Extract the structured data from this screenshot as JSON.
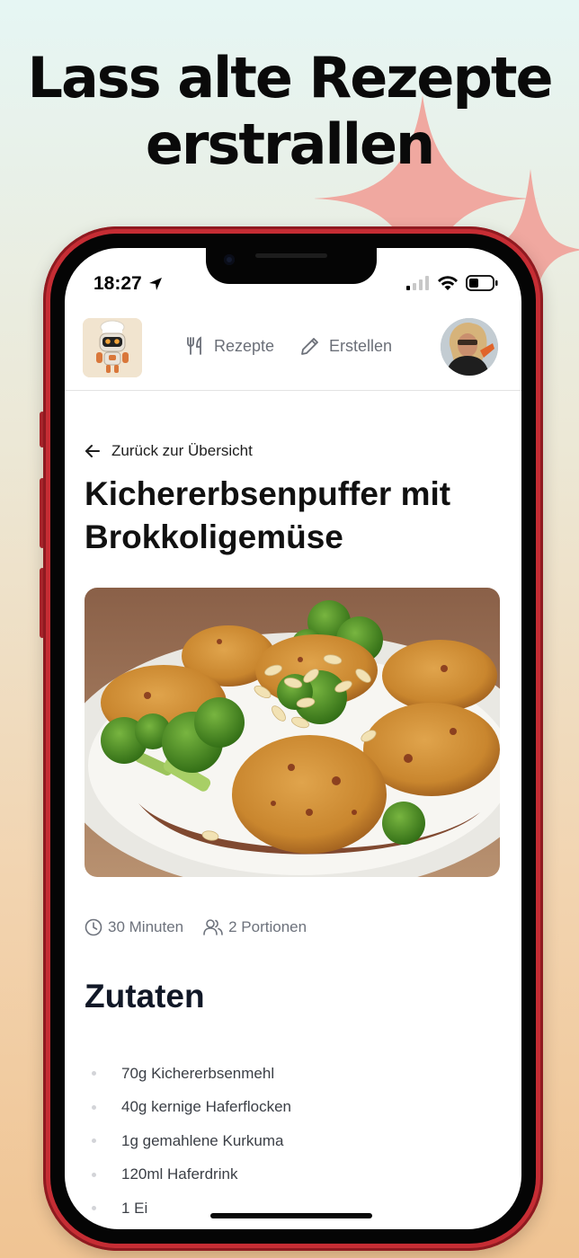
{
  "promo": {
    "headline_line1": "Lass alte Rezepte",
    "headline_line2": "erstrallen"
  },
  "status_bar": {
    "time": "18:27",
    "icons": [
      "location-arrow-icon",
      "cellular-signal-icon",
      "wifi-icon",
      "battery-icon"
    ]
  },
  "nav": {
    "logo": "robot-chef-logo",
    "links": [
      {
        "label": "Rezepte",
        "icon": "fork-knife-icon"
      },
      {
        "label": "Erstellen",
        "icon": "pencil-icon"
      }
    ],
    "avatar": "user-avatar"
  },
  "recipe": {
    "back_label": "Zurück zur Übersicht",
    "title": "Kichererbsenpuffer mit Brokkoligemüse",
    "image": "chickpea-fritters-with-broccoli-photo",
    "duration": "30 Minuten",
    "servings": "2 Portionen",
    "ingredients_title": "Zutaten",
    "ingredients": [
      "70g Kichererbsenmehl",
      "40g kernige Haferflocken",
      "1g gemahlene Kurkuma",
      "120ml Haferdrink",
      "1 Ei"
    ]
  },
  "colors": {
    "phone_frame": "#c62d34",
    "sparkle": "#f0a8a0",
    "title_text": "#111111",
    "muted_text": "#6d727c"
  }
}
